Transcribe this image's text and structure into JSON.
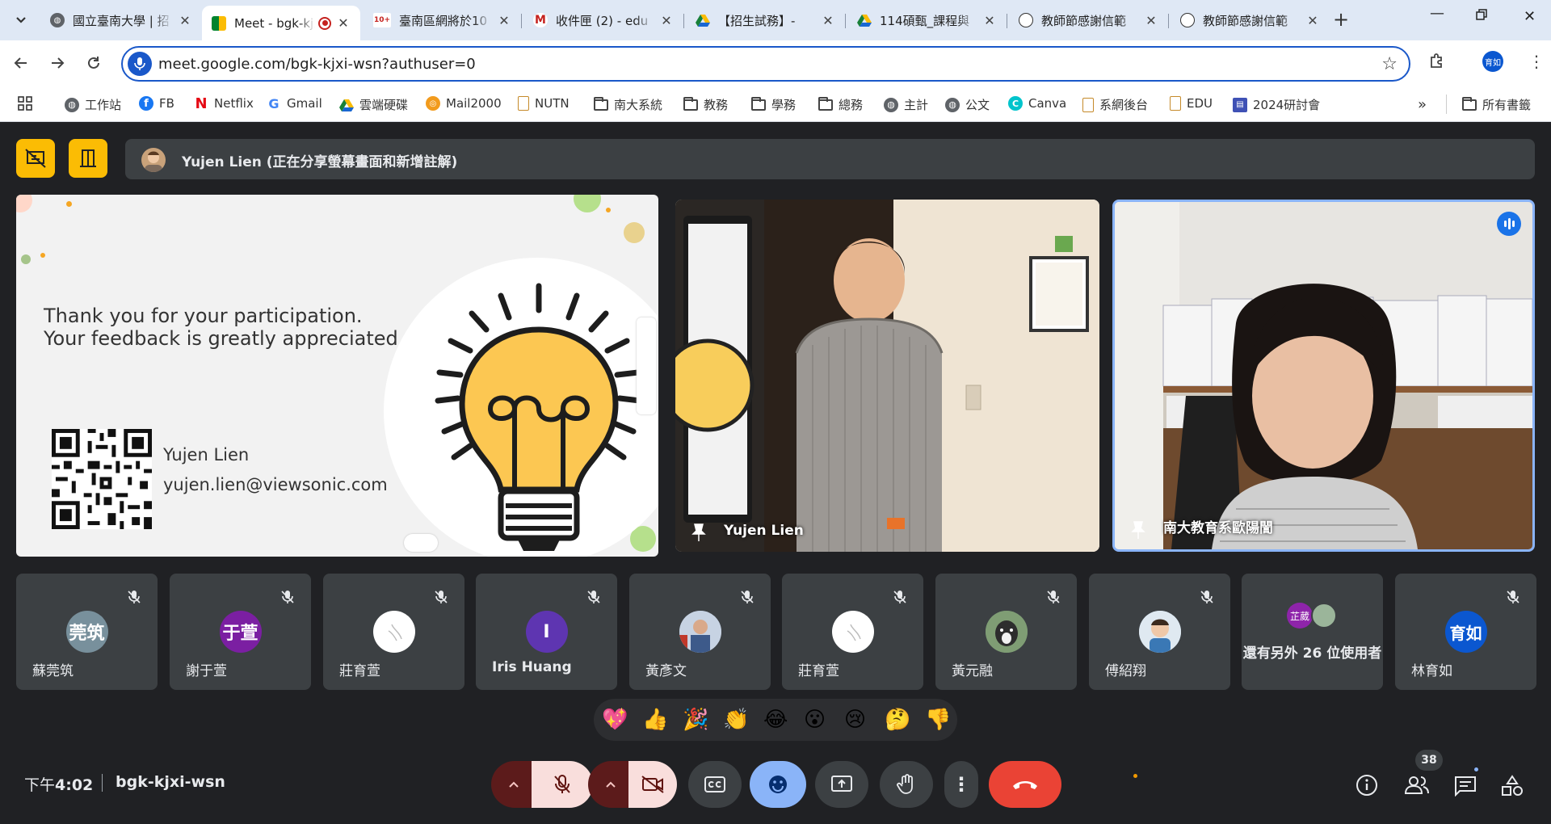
{
  "browser": {
    "tabs": [
      {
        "label": "國立臺南大學 | 招",
        "favicon": "globe-icon"
      },
      {
        "label": "Meet - bgk-kjxi-wsn",
        "favicon": "meet-icon",
        "active": true
      },
      {
        "label": "臺南區網將於10",
        "favicon": "gmail-icon",
        "badge": "10+"
      },
      {
        "label": "收件匣 (2) - edu",
        "favicon": "gmail-icon"
      },
      {
        "label": "【招生試務】-",
        "favicon": "drive-icon"
      },
      {
        "label": "114碩甄_課程與",
        "favicon": "drive-icon"
      },
      {
        "label": "教師節感謝信範",
        "favicon": "chatgpt-icon"
      },
      {
        "label": "教師節感謝信範",
        "favicon": "chatgpt-icon"
      }
    ],
    "url": "meet.google.com/bgk-kjxi-wsn?authuser=0",
    "profile_initials": "育如",
    "bookmarks": [
      {
        "label": "工作站",
        "icon": "globe-icon"
      },
      {
        "label": "FB",
        "icon": "facebook-icon"
      },
      {
        "label": "Netflix",
        "icon": "netflix-icon"
      },
      {
        "label": "Gmail",
        "icon": "google-icon"
      },
      {
        "label": "雲端硬碟",
        "icon": "drive-icon"
      },
      {
        "label": "Mail2000",
        "icon": "mail2000-icon"
      },
      {
        "label": "NUTN",
        "icon": "doc-icon"
      },
      {
        "label": "南大系統",
        "icon": "folder-icon"
      },
      {
        "label": "教務",
        "icon": "folder-icon"
      },
      {
        "label": "學務",
        "icon": "folder-icon"
      },
      {
        "label": "總務",
        "icon": "folder-icon"
      },
      {
        "label": "主計",
        "icon": "globe-icon"
      },
      {
        "label": "公文",
        "icon": "globe-icon"
      },
      {
        "label": "Canva",
        "icon": "canva-icon"
      },
      {
        "label": "系網後台",
        "icon": "doc-icon"
      },
      {
        "label": "EDU",
        "icon": "doc-icon"
      },
      {
        "label": "2024研討會",
        "icon": "forms-icon"
      }
    ],
    "all_bookmarks": "所有書籤",
    "more": "»"
  },
  "meet": {
    "presenter_text": "Yujen Lien (正在分享螢幕畫面和新增註解)",
    "slide": {
      "line1": "Thank you for your participation.",
      "line2": "Your feedback is greatly appreciated.",
      "name": "Yujen Lien",
      "email": "yujen.lien@viewsonic.com"
    },
    "videos": [
      {
        "name": "Yujen Lien"
      },
      {
        "name": "南大教育系歐陽誾"
      }
    ],
    "participants": [
      {
        "name": "蘇莞筑",
        "avatar_text": "莞筑",
        "avatar_color": "#78909c"
      },
      {
        "name": "謝于萱",
        "avatar_text": "于萱",
        "avatar_color": "#7b1fa2"
      },
      {
        "name": "莊育萱",
        "avatar_text": "",
        "avatar_color": "#ffffff"
      },
      {
        "name": "Iris Huang",
        "avatar_text": "I",
        "avatar_color": "#5e35b1"
      },
      {
        "name": "黃彥文",
        "avatar_text": "",
        "avatar_color": "#8d9db6"
      },
      {
        "name": "莊育萱",
        "avatar_text": "",
        "avatar_color": "#ffffff"
      },
      {
        "name": "黃元融",
        "avatar_text": "",
        "avatar_color": "#6b8f71"
      },
      {
        "name": "傅紹翔",
        "avatar_text": "",
        "avatar_color": "#a9c4dc"
      },
      {
        "name": "還有另外 26 位使用者",
        "avatar_text": "芷葳",
        "avatar_color": "#8e24aa"
      },
      {
        "name": "林育如",
        "avatar_text": "育如",
        "avatar_color": "#0b57d0"
      }
    ],
    "reactions": [
      "💖",
      "👍",
      "🎉",
      "👏",
      "😂",
      "😮",
      "😢",
      "🤔",
      "👎"
    ],
    "clock_prefix": "下午",
    "clock_time": "4:02",
    "meeting_code": "bgk-kjxi-wsn",
    "people_count": "38",
    "colors": {
      "accent_red": "#ea4335",
      "highlight": "#8ab4f8",
      "yellow": "#fbbc04"
    }
  }
}
